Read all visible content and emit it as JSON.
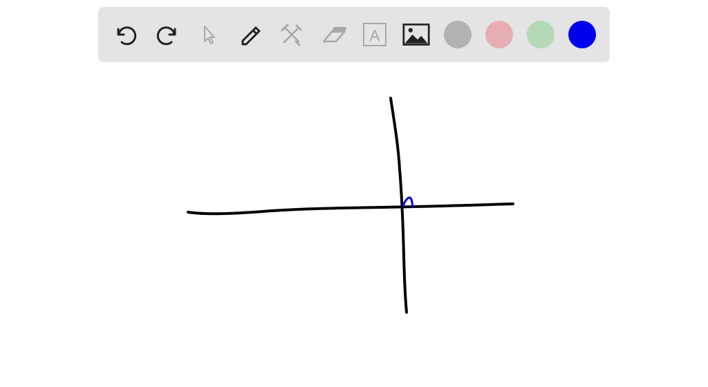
{
  "toolbar": {
    "tools": [
      {
        "name": "undo",
        "icon": "undo-icon",
        "enabled": true
      },
      {
        "name": "redo",
        "icon": "redo-icon",
        "enabled": true
      },
      {
        "name": "select",
        "icon": "pointer-icon",
        "enabled": false
      },
      {
        "name": "pen",
        "icon": "pencil-icon",
        "enabled": true
      },
      {
        "name": "tools",
        "icon": "tools-icon",
        "enabled": false
      },
      {
        "name": "eraser",
        "icon": "eraser-icon",
        "enabled": false
      },
      {
        "name": "text",
        "icon": "text-icon",
        "enabled": false,
        "glyph": "A"
      },
      {
        "name": "image",
        "icon": "image-icon",
        "enabled": true
      }
    ],
    "colors": [
      {
        "name": "gray",
        "hex": "#b2b2b2"
      },
      {
        "name": "pink",
        "hex": "#e6aeb3"
      },
      {
        "name": "green",
        "hex": "#b4d9b4"
      },
      {
        "name": "blue",
        "hex": "#0000ee"
      }
    ],
    "active_color": "blue",
    "icon_color_enabled": "#222222",
    "icon_color_disabled": "#a8a8a8"
  },
  "canvas": {
    "stroke_color_primary": "#000000",
    "stroke_color_accent": "#0000ee"
  }
}
